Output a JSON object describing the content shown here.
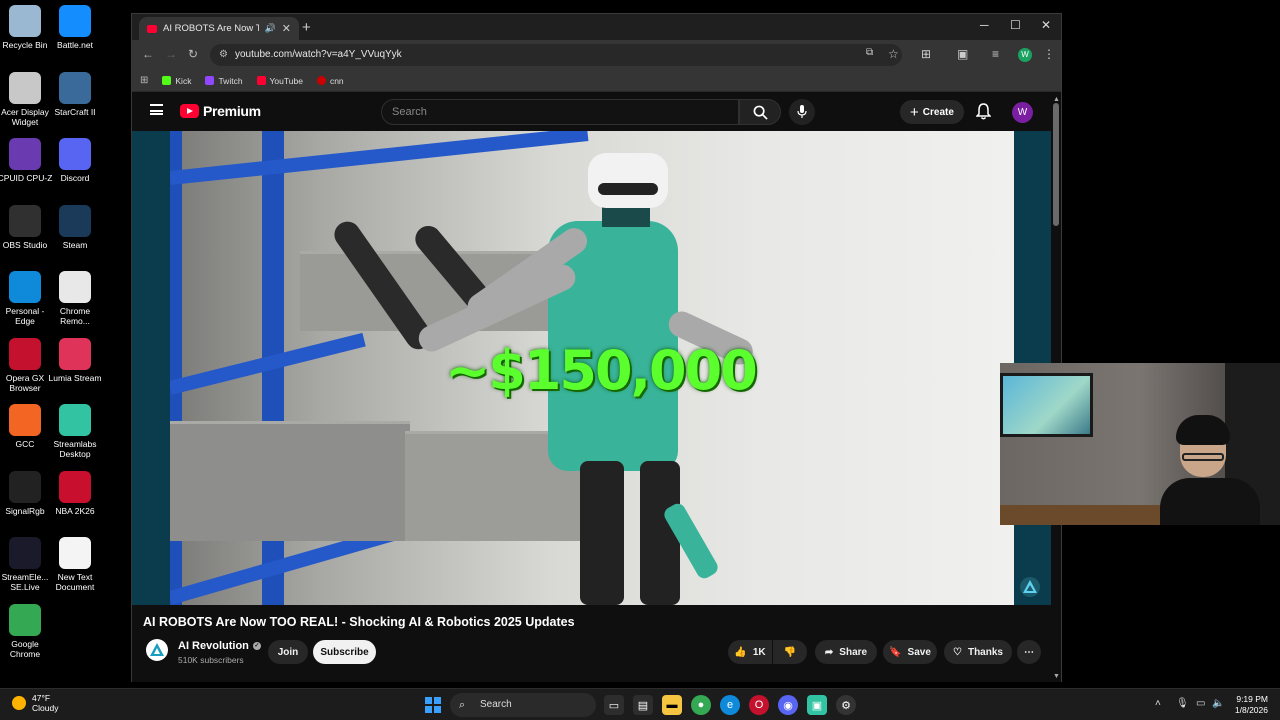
{
  "desktop": {
    "icons": [
      {
        "label": "Recycle Bin",
        "icon": "recycle-bin-icon",
        "color": "#9bb8d3"
      },
      {
        "label": "Battle.net",
        "icon": "battlenet-icon",
        "color": "#148eff"
      },
      {
        "label": "Acer Display Widget",
        "icon": "acer-widget-icon",
        "color": "#c8c8c8"
      },
      {
        "label": "StarCraft II",
        "icon": "starcraft-icon",
        "color": "#3a6a9a"
      },
      {
        "label": "CPUID CPU-Z",
        "icon": "cpuz-icon",
        "color": "#6a3ab0"
      },
      {
        "label": "Discord",
        "icon": "discord-icon",
        "color": "#5865f2"
      },
      {
        "label": "OBS Studio",
        "icon": "obs-icon",
        "color": "#303030"
      },
      {
        "label": "Steam",
        "icon": "steam-icon",
        "color": "#1b3a5a"
      },
      {
        "label": "Personal - Edge",
        "icon": "edge-icon",
        "color": "#0f8adb"
      },
      {
        "label": "Chrome Remo...",
        "icon": "chrome-remote-icon",
        "color": "#e8e8e8"
      },
      {
        "label": "Opera GX Browser",
        "icon": "opera-gx-icon",
        "color": "#c4122e"
      },
      {
        "label": "Lumia Stream",
        "icon": "lumia-icon",
        "color": "#e0335a"
      },
      {
        "label": "GCC",
        "icon": "gcc-icon",
        "color": "#f26522"
      },
      {
        "label": "Streamlabs Desktop",
        "icon": "streamlabs-icon",
        "color": "#31c3a2"
      },
      {
        "label": "SignalRgb",
        "icon": "signalrgb-icon",
        "color": "#222"
      },
      {
        "label": "NBA 2K26",
        "icon": "nba2k-icon",
        "color": "#c8102e"
      },
      {
        "label": "StreamEle... SE.Live",
        "icon": "streamelements-icon",
        "color": "#1a1a2a"
      },
      {
        "label": "New Text Document",
        "icon": "text-document-icon",
        "color": "#f4f4f4"
      },
      {
        "label": "Google Chrome",
        "icon": "chrome-icon",
        "color": "#34a853"
      }
    ]
  },
  "browser": {
    "tab_title": "AI ROBOTS Are Now TOO R",
    "url": "youtube.com/watch?v=a4Y_VVuqYyk",
    "bookmarks": [
      {
        "label": "Kick",
        "color": "#53fc18"
      },
      {
        "label": "Twitch",
        "color": "#9146ff"
      },
      {
        "label": "YouTube",
        "color": "#ff0033"
      },
      {
        "label": "cnn",
        "color": "#cc0000"
      }
    ],
    "profile_initial": "W"
  },
  "youtube": {
    "logo_text": "Premium",
    "search_placeholder": "Search",
    "create_label": "Create",
    "avatar_initial": "W",
    "video_overlay_text": "~$150,000",
    "video_title": "AI ROBOTS Are Now TOO REAL! - Shocking AI & Robotics 2025 Updates",
    "channel_name": "AI Revolution",
    "subscribers": "510K subscribers",
    "join_label": "Join",
    "subscribe_label": "Subscribe",
    "like_count": "1K",
    "share_label": "Share",
    "save_label": "Save",
    "thanks_label": "Thanks"
  },
  "taskbar": {
    "temperature": "47°F",
    "weather": "Cloudy",
    "search_label": "Search",
    "time": "9:19 PM",
    "date": "1/8/2026"
  }
}
